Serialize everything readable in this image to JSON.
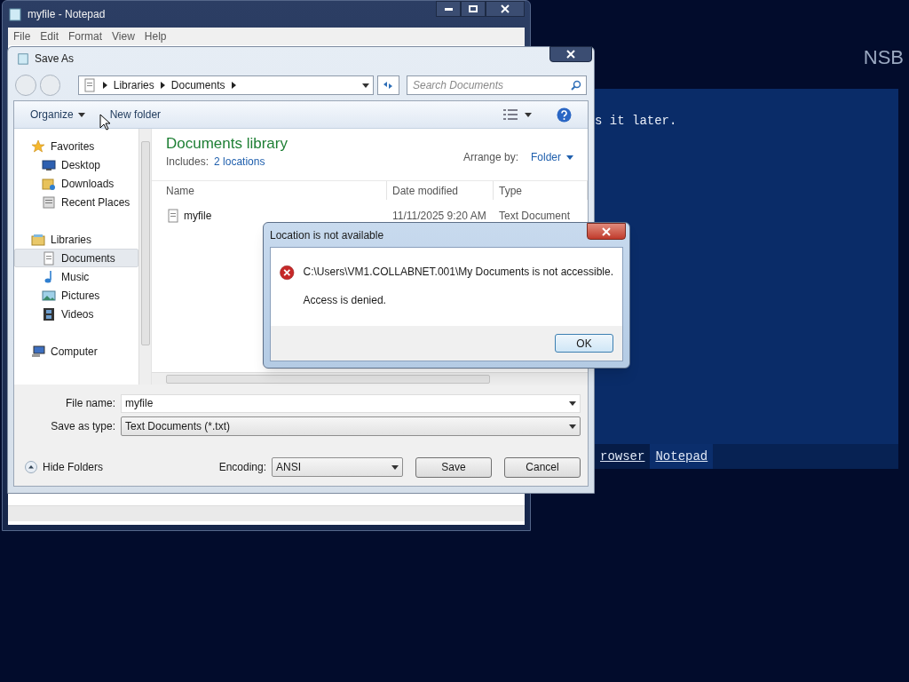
{
  "desktop": {
    "brand": "NSB",
    "console_text": "s it later.",
    "links": [
      {
        "label": "rowser",
        "selected": false
      },
      {
        "label": "Notepad",
        "selected": true
      }
    ]
  },
  "notepad": {
    "title": "myfile - Notepad",
    "menu": [
      "File",
      "Edit",
      "Format",
      "View",
      "Help"
    ]
  },
  "save_as": {
    "title": "Save As",
    "breadcrumb": [
      "Libraries",
      "Documents"
    ],
    "search": {
      "placeholder": "Search Documents"
    },
    "organize": "Organize",
    "new_folder": "New folder",
    "nav": [
      {
        "label": "Favorites",
        "kind": "star",
        "selected": false,
        "children": [
          {
            "label": "Desktop",
            "kind": "desktop",
            "selected": false
          },
          {
            "label": "Downloads",
            "kind": "downloads",
            "selected": false
          },
          {
            "label": "Recent Places",
            "kind": "recent",
            "selected": false
          }
        ]
      },
      {
        "label": "Libraries",
        "kind": "library",
        "selected": false,
        "children": [
          {
            "label": "Documents",
            "kind": "document",
            "selected": true
          },
          {
            "label": "Music",
            "kind": "music",
            "selected": false
          },
          {
            "label": "Pictures",
            "kind": "pictures",
            "selected": false
          },
          {
            "label": "Videos",
            "kind": "videos",
            "selected": false
          }
        ]
      },
      {
        "label": "Computer",
        "kind": "computer",
        "selected": false
      }
    ],
    "library": {
      "title": "Documents library",
      "includes_label": "Includes:",
      "includes_link": "2 locations",
      "arrange_label": "Arrange by:",
      "arrange_value": "Folder"
    },
    "columns": [
      "Name",
      "Date modified",
      "Type"
    ],
    "rows": [
      {
        "name": "myfile",
        "date": "11/11/2025 9:20 AM",
        "type": "Text Document"
      }
    ],
    "file_name_label": "File name:",
    "file_name": "myfile",
    "type_label": "Save as type:",
    "type_value": "Text Documents (*.txt)",
    "hide_folders": "Hide Folders",
    "encoding_label": "Encoding:",
    "encoding": "ANSI",
    "buttons": [
      "Save",
      "Cancel"
    ]
  },
  "error": {
    "title": "Location is not available",
    "message": "C:\\Users\\VM1.COLLABNET.001\\My Documents is not accessible.",
    "detail": "Access is denied.",
    "button": "OK"
  }
}
